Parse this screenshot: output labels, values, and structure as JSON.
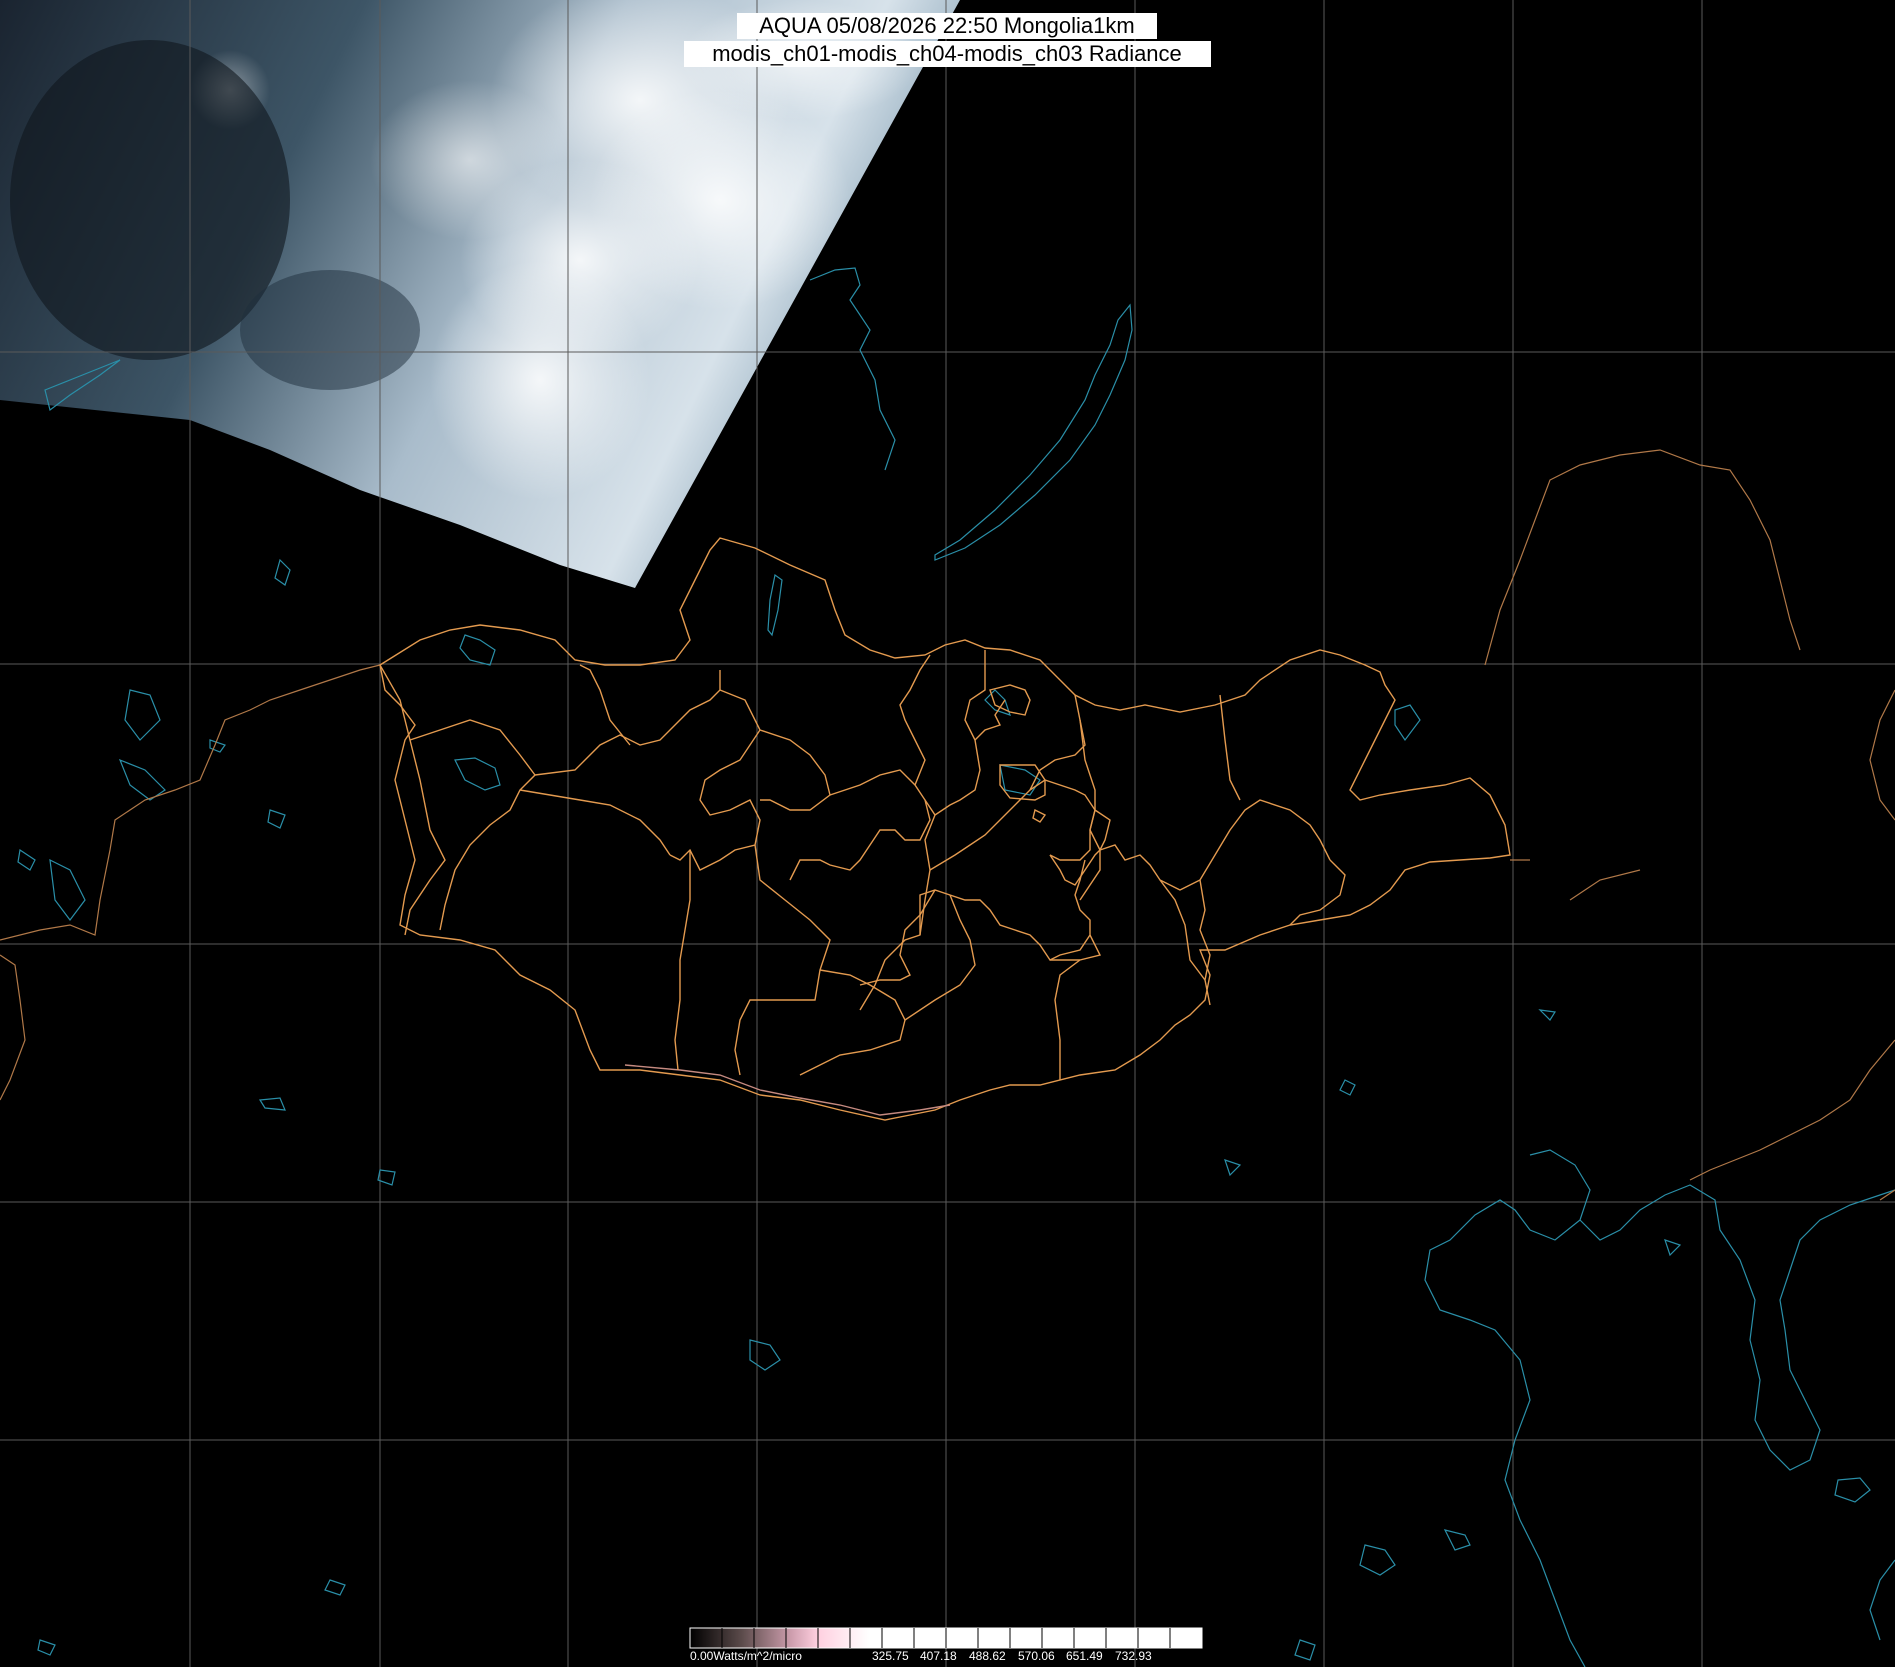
{
  "title": {
    "line1": "AQUA 05/08/2026 22:50 Mongolia1km",
    "line2": "modis_ch01-modis_ch04-modis_ch03 Radiance"
  },
  "colorbar": {
    "labels": [
      "0.00Watts/m^2/micro",
      "325.75",
      "407.18",
      "488.62",
      "570.06",
      "651.49",
      "732.93"
    ]
  },
  "colors": {
    "background": "#000000",
    "grid": "#5a5a5a",
    "admin_boundary": "#e39a4f",
    "country_border": "#b07848",
    "coastline_water": "#2a8fa8"
  }
}
